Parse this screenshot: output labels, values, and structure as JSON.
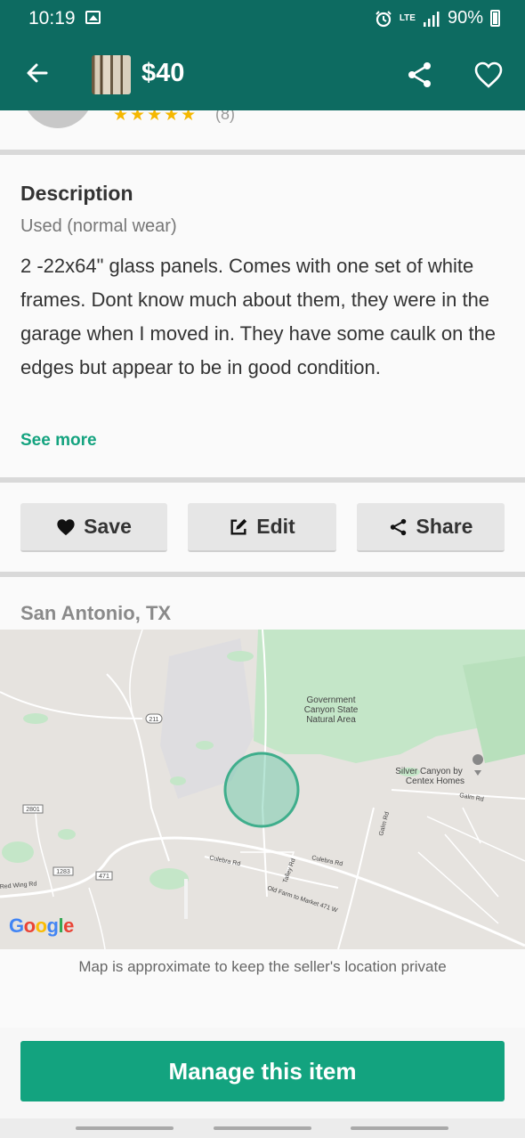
{
  "status_bar": {
    "time": "10:19",
    "network": "LTE",
    "battery": "90%"
  },
  "app_bar": {
    "price": "$40"
  },
  "seller": {
    "stars": "★★★★★",
    "review_count": "(8)"
  },
  "description": {
    "heading": "Description",
    "condition": "Used (normal wear)",
    "body": "2 -22x64\" glass panels. Comes with one set of white frames. Dont know much about them, they were in the garage when I moved in. They have some caulk on the edges but appear to be in good condition.",
    "see_more": "See more"
  },
  "actions": {
    "save": "Save",
    "edit": "Edit",
    "share": "Share"
  },
  "location": {
    "city": "San Antonio, TX",
    "map_labels": {
      "park": [
        "Government",
        "Canyon State",
        "Natural Area"
      ],
      "poi": [
        "Silver Canyon by",
        "Centex Homes"
      ],
      "road_211": "211",
      "road_2801": "2801",
      "road_1283": "1283",
      "road_471": "471",
      "culebra_rd_1": "Culebra Rd",
      "culebra_rd_2": "Culebra Rd",
      "talley_rd": "Talley Rd",
      "galm_rd_1": "Galm Rd",
      "galm_rd_2": "Galm Rd",
      "old_farm": "Old Farm to Market 471 W",
      "red_wing": "Red Wing Rd"
    },
    "google": "Google",
    "note": "Map is approximate to keep the seller's location private"
  },
  "manage_button": "Manage this item",
  "colors": {
    "primary": "#0d6b61",
    "accent": "#13a37f",
    "star": "#f5b800"
  },
  "icons": [
    "photo-icon",
    "alarm-icon",
    "signal-icon",
    "battery-icon",
    "back-arrow-icon",
    "share-icon",
    "heart-icon",
    "edit-icon",
    "location-pin-icon"
  ]
}
